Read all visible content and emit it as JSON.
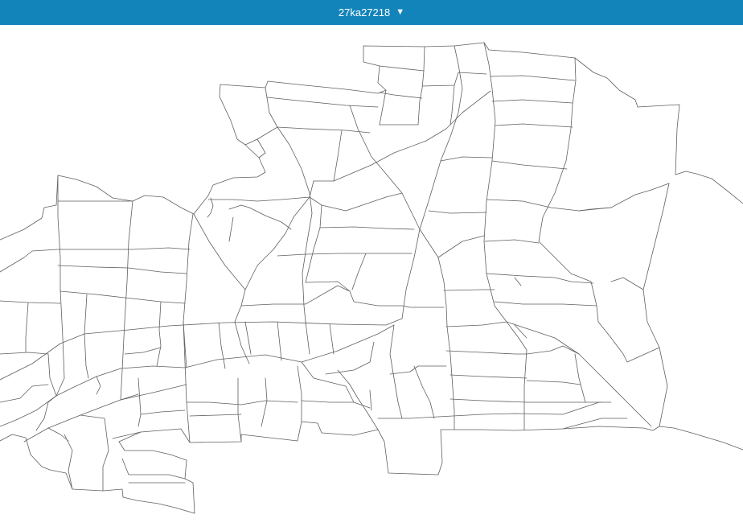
{
  "header": {
    "title": "27ka27218",
    "dropdown_icon": "triangle-down-icon",
    "background_color": "#1384ba",
    "text_color": "#ffffff"
  },
  "map": {
    "background_color": "#ffffff",
    "boundary_color": "#5f5f5f"
  }
}
